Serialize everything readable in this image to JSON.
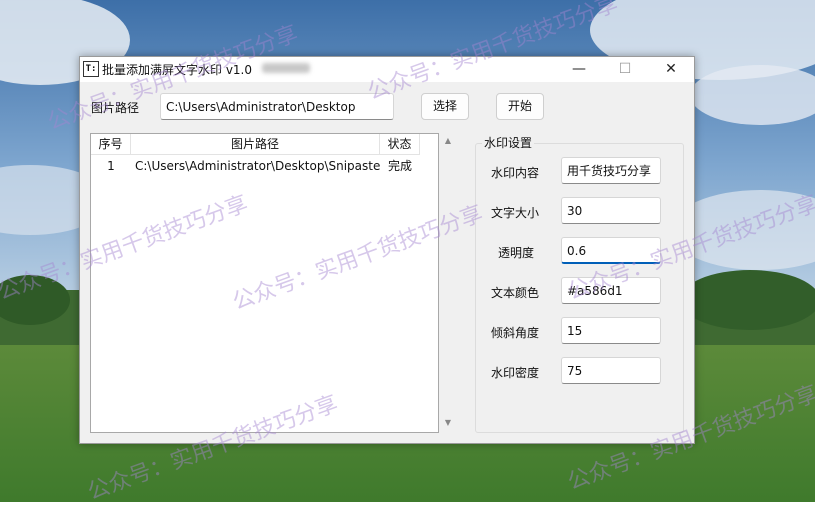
{
  "watermark_text": "公众号：实用千货技巧分享",
  "window": {
    "title": "批量添加满屏文字水印 v1.0",
    "icon_glyph": "T:",
    "minimize_glyph": "—",
    "maximize_glyph": "☐",
    "close_glyph": "✕"
  },
  "path_row": {
    "label": "图片路径",
    "value": "C:\\Users\\Administrator\\Desktop",
    "select_button": "选择",
    "start_button": "开始"
  },
  "table": {
    "headers": [
      "序号",
      "图片路径",
      "状态"
    ],
    "rows": [
      {
        "index": "1",
        "path": "C:\\Users\\Administrator\\Desktop\\Snipaste",
        "status": "完成"
      }
    ]
  },
  "settings": {
    "title": "水印设置",
    "content_label": "水印内容",
    "content_value": "用千货技巧分享",
    "size_label": "文字大小",
    "size_value": "30",
    "opacity_label": "透明度",
    "opacity_value": "0.6",
    "color_label": "文本颜色",
    "color_value": "#a586d1",
    "angle_label": "倾斜角度",
    "angle_value": "15",
    "density_label": "水印密度",
    "density_value": "75"
  },
  "colors": {
    "accent": "#005fb8",
    "watermark": "#a586d1"
  }
}
